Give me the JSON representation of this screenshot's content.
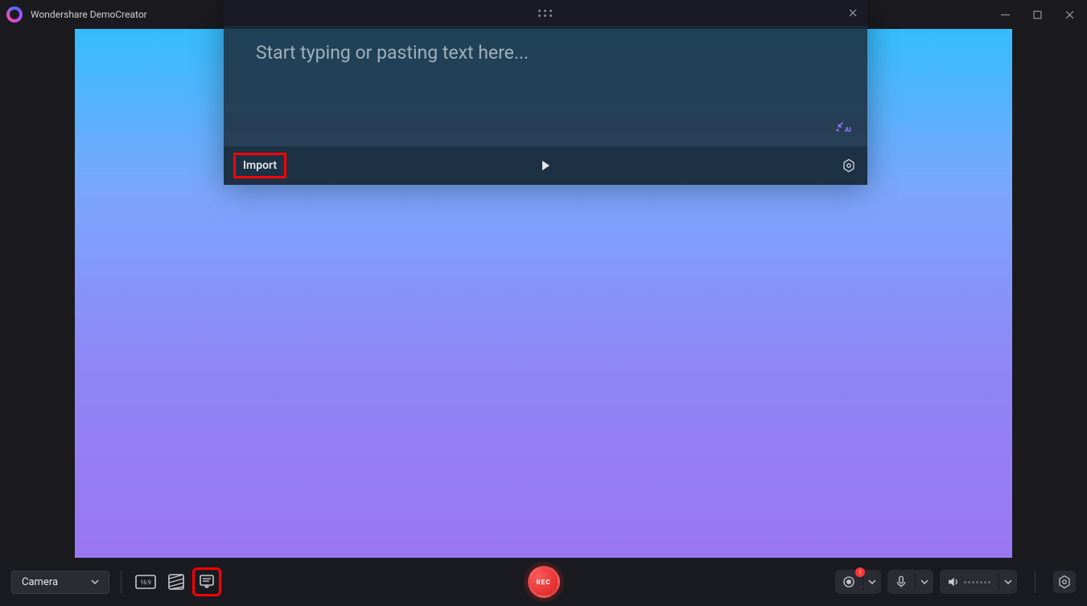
{
  "app": {
    "title": "Wondershare DemoCreator"
  },
  "panel": {
    "placeholder": "Start typing or pasting text here...",
    "import_label": "Import"
  },
  "toolbar": {
    "mode_label": "Camera",
    "record_label": "REC",
    "camera_badge": "!"
  }
}
